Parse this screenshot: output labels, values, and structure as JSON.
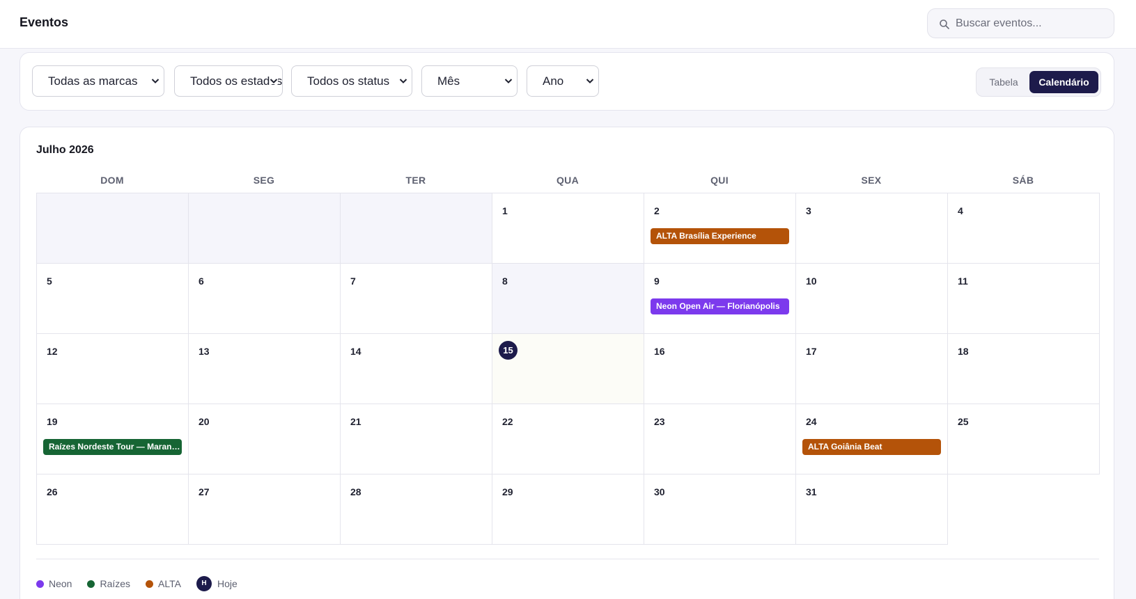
{
  "header": {
    "title": "Eventos"
  },
  "search": {
    "placeholder": "Buscar eventos..."
  },
  "filters": {
    "brand": "Todas as marcas",
    "state": "Todos os estados",
    "status": "Todos os status",
    "month": "Mês",
    "year": "Ano"
  },
  "view_toggle": {
    "table_label": "Tabela",
    "calendar_label": "Calendário",
    "selected": "Calendário"
  },
  "calendar": {
    "month_title": "Julho 2026",
    "weekdays": [
      "DOM",
      "SEG",
      "TER",
      "QUA",
      "QUI",
      "SEX",
      "SÁB"
    ],
    "today": 15,
    "days": [
      "1",
      "2",
      "3",
      "4",
      "5",
      "6",
      "7",
      "8",
      "9",
      "10",
      "11",
      "12",
      "13",
      "14",
      "15",
      "16",
      "17",
      "18",
      "19",
      "20",
      "21",
      "22",
      "23",
      "24",
      "25",
      "26",
      "27",
      "28",
      "29",
      "30",
      "31"
    ],
    "events": [
      {
        "day": 2,
        "title": "ALTA Brasília Experience",
        "brand": "ALTA"
      },
      {
        "day": 9,
        "title": "Neon Open Air — Florianópolis",
        "brand": "Neon"
      },
      {
        "day": 19,
        "title": "Raízes Nordeste Tour — Maranhão",
        "brand": "Raízes"
      },
      {
        "day": 24,
        "title": "ALTA Goiânia Beat",
        "brand": "ALTA"
      }
    ]
  },
  "legend": {
    "items": [
      {
        "label": "Neon",
        "color": "#7c3aed"
      },
      {
        "label": "Raízes",
        "color": "#166534"
      },
      {
        "label": "ALTA",
        "color": "#b45309"
      }
    ],
    "today_badge": "H",
    "today_label": "Hoje"
  },
  "colors": {
    "accent": "#1d1b4b",
    "neon": "#7c3aed",
    "raizes": "#166534",
    "alta": "#b45309"
  }
}
